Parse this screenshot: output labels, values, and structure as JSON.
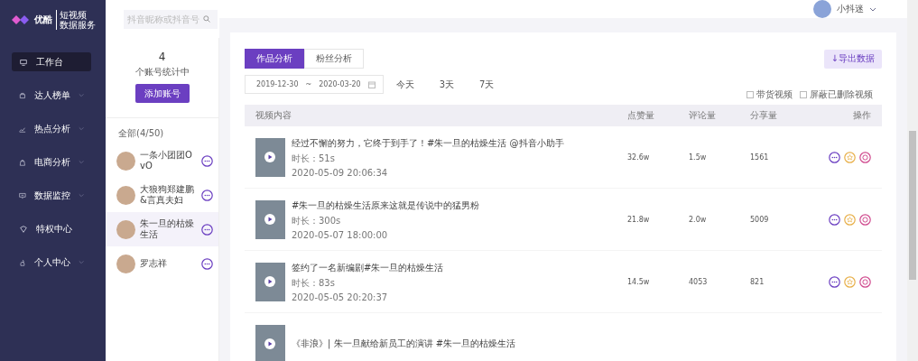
{
  "logo": {
    "name": "优酷",
    "tagline_1": "短视频",
    "tagline_2": "数据服务"
  },
  "sidebar": {
    "items": [
      {
        "label": "工作台",
        "selected": true,
        "expandable": false
      },
      {
        "label": "达人榜单",
        "selected": false,
        "expandable": true
      },
      {
        "label": "热点分析",
        "selected": false,
        "expandable": true
      },
      {
        "label": "电商分析",
        "selected": false,
        "expandable": true
      },
      {
        "label": "数据监控",
        "selected": false,
        "expandable": true
      },
      {
        "label": "特权中心",
        "selected": false,
        "expandable": false
      },
      {
        "label": "个人中心",
        "selected": false,
        "expandable": true
      }
    ]
  },
  "search": {
    "placeholder": "抖音昵称或抖音号"
  },
  "user": {
    "name": "小抖迷"
  },
  "accounts": {
    "count": "4",
    "caption": "个账号统计中",
    "add_button": "添加账号",
    "group_label": "全部(4/50)",
    "items": [
      {
        "name": "一条小团团OvO",
        "selected": false
      },
      {
        "name": "大狼狗郑建鹏&言真夫妇",
        "selected": false
      },
      {
        "name": "朱一旦的枯燥生活",
        "selected": true
      },
      {
        "name": "罗志祥",
        "selected": false
      }
    ]
  },
  "tabs": [
    {
      "label": "作品分析",
      "selected": true
    },
    {
      "label": "粉丝分析",
      "selected": false
    }
  ],
  "export_button": "↓导出数据",
  "date_range": {
    "start": "2019-12-30",
    "separator": "~",
    "end": "2020-03-20"
  },
  "quick_ranges": [
    "今天",
    "3天",
    "7天"
  ],
  "filters": [
    {
      "label": "带货视频",
      "checked": false
    },
    {
      "label": "屏蔽已删除视频",
      "checked": false
    }
  ],
  "table": {
    "columns": [
      "视频内容",
      "点赞量",
      "评论量",
      "分享量",
      "操作"
    ],
    "rows": [
      {
        "title": "经过不懈的努力，它终于到手了！#朱一旦的枯燥生活 @抖音小助手",
        "duration": "时长：51s",
        "date": "2020-05-09 20:06:34",
        "likes": "32.6w",
        "comments": "1.5w",
        "shares": "1561"
      },
      {
        "title": "#朱一旦的枯燥生活原来这就是传说中的猛男粉",
        "duration": "时长：300s",
        "date": "2020-05-07 18:00:00",
        "likes": "21.8w",
        "comments": "2.0w",
        "shares": "5009"
      },
      {
        "title": "签约了一名新编剧#朱一旦的枯燥生活",
        "duration": "时长：83s",
        "date": "2020-05-05 20:20:37",
        "likes": "14.5w",
        "comments": "4053",
        "shares": "821"
      },
      {
        "title": "《非浪》| 朱一旦献给新员工的演讲 #朱一旦的枯燥生活"
      }
    ]
  }
}
